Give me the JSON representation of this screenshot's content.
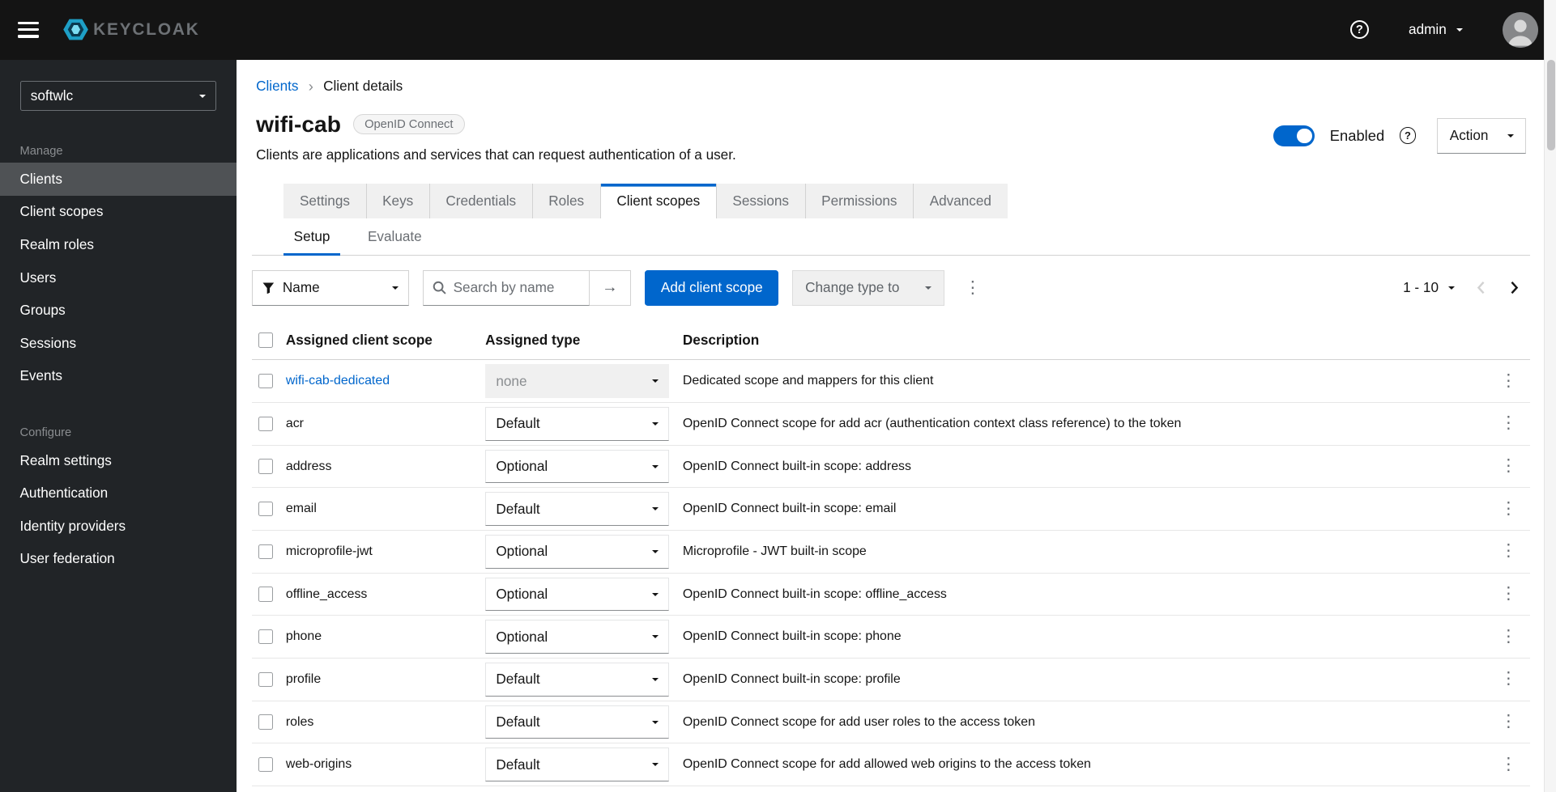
{
  "colors": {
    "primary": "#0066cc",
    "link": "#0066cc",
    "header_bg": "#141414",
    "sidebar_bg": "#212427",
    "sidebar_active_bg": "#4f5255",
    "toggle_on": "#0066cc"
  },
  "icons": {
    "kebab": "⋮",
    "breadcrumb_separator": "›",
    "search_submit_arrow": "→",
    "help": "?"
  },
  "header": {
    "brand": "KEYCLOAK",
    "username": "admin"
  },
  "sidebar": {
    "realm": "softwlc",
    "sections": [
      {
        "title": "Manage",
        "items": [
          {
            "label": "Clients",
            "active": true
          },
          {
            "label": "Client scopes"
          },
          {
            "label": "Realm roles"
          },
          {
            "label": "Users"
          },
          {
            "label": "Groups"
          },
          {
            "label": "Sessions"
          },
          {
            "label": "Events"
          }
        ]
      },
      {
        "title": "Configure",
        "items": [
          {
            "label": "Realm settings"
          },
          {
            "label": "Authentication"
          },
          {
            "label": "Identity providers"
          },
          {
            "label": "User federation"
          }
        ]
      }
    ]
  },
  "breadcrumb": {
    "items": [
      "Clients",
      "Client details"
    ]
  },
  "page": {
    "title": "wifi-cab",
    "badge": "OpenID Connect",
    "description": "Clients are applications and services that can request authentication of a user.",
    "enabled_label": "Enabled",
    "action_label": "Action"
  },
  "tabs": {
    "items": [
      {
        "label": "Settings"
      },
      {
        "label": "Keys"
      },
      {
        "label": "Credentials"
      },
      {
        "label": "Roles"
      },
      {
        "label": "Client scopes",
        "active": true
      },
      {
        "label": "Sessions"
      },
      {
        "label": "Permissions"
      },
      {
        "label": "Advanced"
      }
    ]
  },
  "subtabs": {
    "items": [
      {
        "label": "Setup",
        "active": true
      },
      {
        "label": "Evaluate"
      }
    ]
  },
  "toolbar": {
    "filter_label": "Name",
    "search_placeholder": "Search by name",
    "add_button_label": "Add client scope",
    "change_type_label": "Change type to",
    "pagination_label": "1 - 10"
  },
  "table": {
    "columns": [
      "Assigned client scope",
      "Assigned type",
      "Description"
    ],
    "rows": [
      {
        "name": "wifi-cab-dedicated",
        "link": true,
        "type": "none",
        "disabled": true,
        "description": "Dedicated scope and mappers for this client"
      },
      {
        "name": "acr",
        "type": "Default",
        "description": "OpenID Connect scope for add acr (authentication context class reference) to the token"
      },
      {
        "name": "address",
        "type": "Optional",
        "description": "OpenID Connect built-in scope: address"
      },
      {
        "name": "email",
        "type": "Default",
        "description": "OpenID Connect built-in scope: email"
      },
      {
        "name": "microprofile-jwt",
        "type": "Optional",
        "description": "Microprofile - JWT built-in scope"
      },
      {
        "name": "offline_access",
        "type": "Optional",
        "description": "OpenID Connect built-in scope: offline_access"
      },
      {
        "name": "phone",
        "type": "Optional",
        "description": "OpenID Connect built-in scope: phone"
      },
      {
        "name": "profile",
        "type": "Default",
        "description": "OpenID Connect built-in scope: profile"
      },
      {
        "name": "roles",
        "type": "Default",
        "description": "OpenID Connect scope for add user roles to the access token"
      },
      {
        "name": "web-origins",
        "type": "Default",
        "description": "OpenID Connect scope for add allowed web origins to the access token"
      }
    ]
  }
}
